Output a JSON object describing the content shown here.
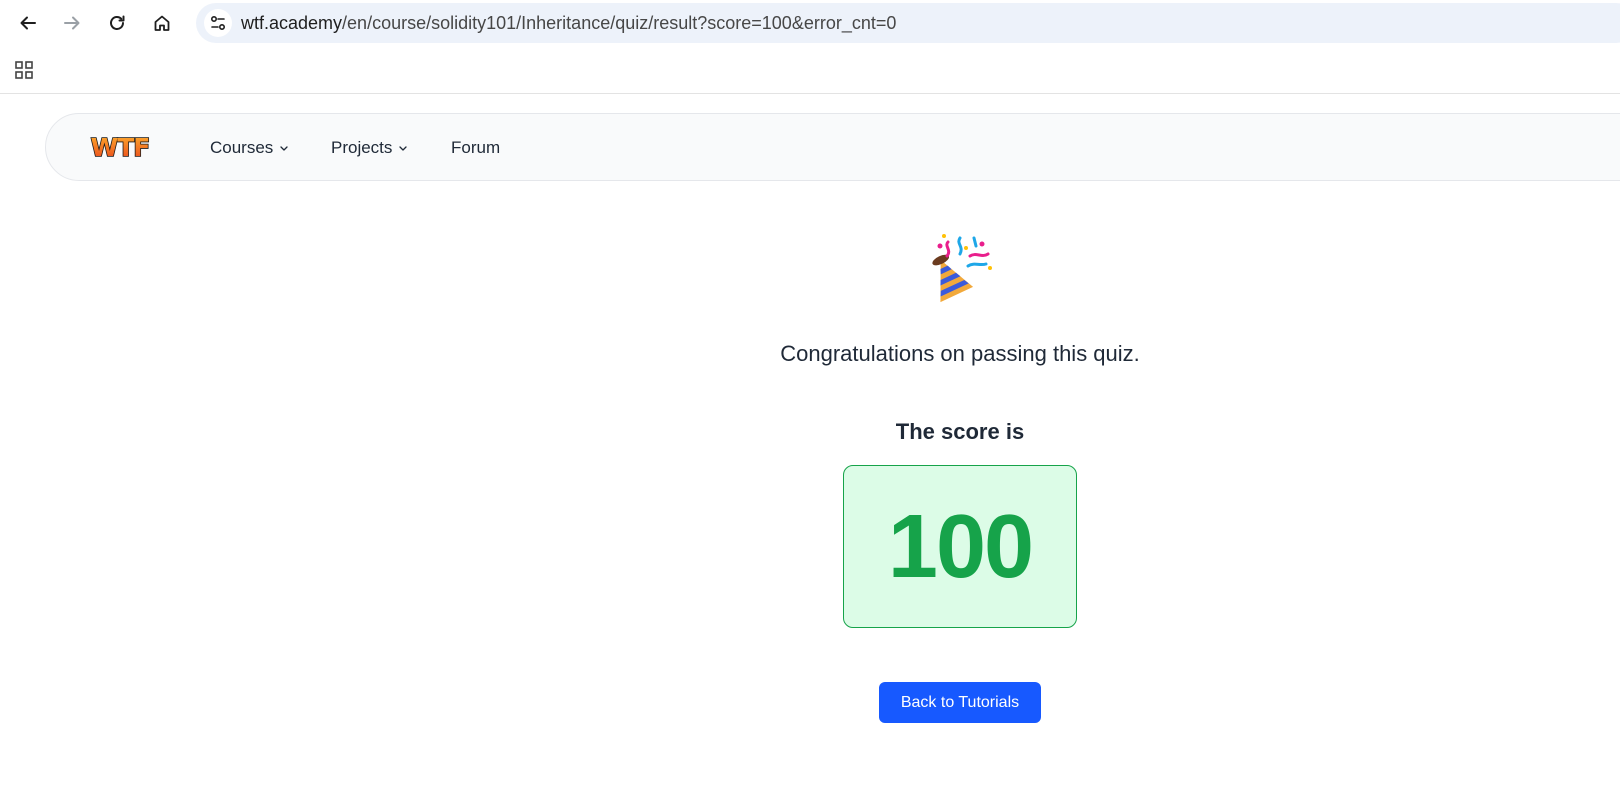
{
  "browser": {
    "url_host": "wtf.academy",
    "url_path": "/en/course/solidity101/Inheritance/quiz/result?score=100&error_cnt=0",
    "icons": {
      "back": "arrow-left-icon",
      "forward": "arrow-right-icon",
      "reload": "reload-icon",
      "home": "home-icon",
      "site_info": "tune-icon",
      "apps": "apps-grid-icon"
    }
  },
  "header": {
    "logo_text": "WTF",
    "menu": [
      {
        "label": "Courses",
        "has_dropdown": true
      },
      {
        "label": "Projects",
        "has_dropdown": true
      },
      {
        "label": "Forum",
        "has_dropdown": false
      }
    ]
  },
  "result": {
    "icon": "party-popper-icon",
    "message": "Congratulations on passing this quiz.",
    "score_label": "The score is",
    "score": "100",
    "back_button_label": "Back to Tutorials"
  },
  "colors": {
    "score_text": "#16a34a",
    "score_bg": "#dcfce7",
    "button_bg": "#1759ff"
  }
}
